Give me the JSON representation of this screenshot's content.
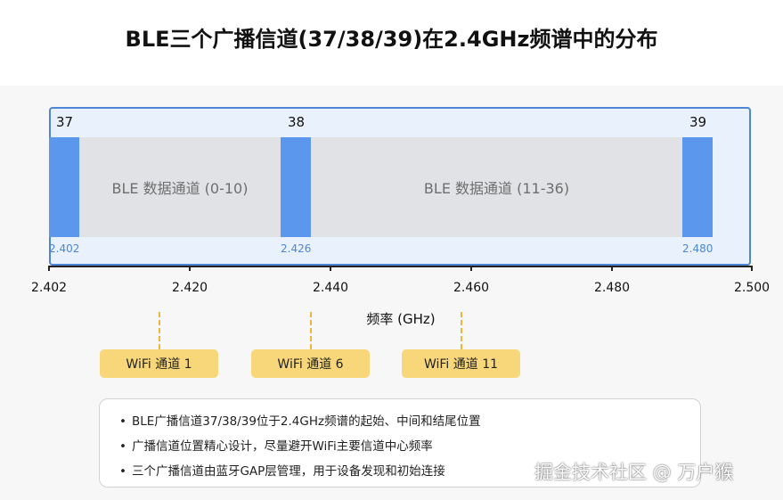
{
  "title": "BLE三个广播信道(37/38/39)在2.4GHz频谱中的分布",
  "chart_data": {
    "type": "diagram",
    "xlim": [
      2.402,
      2.5
    ],
    "x_ticks": [
      "2.402",
      "2.420",
      "2.440",
      "2.460",
      "2.480",
      "2.500"
    ],
    "x_label": "频率 (GHz)",
    "advertising_channels": [
      {
        "channel": "37",
        "freq_label": "2.402"
      },
      {
        "channel": "38",
        "freq_label": "2.426"
      },
      {
        "channel": "39",
        "freq_label": "2.480"
      }
    ],
    "data_regions": [
      {
        "label": "BLE 数据通道 (0-10)"
      },
      {
        "label": "BLE 数据通道 (11-36)"
      }
    ],
    "wifi_channels": [
      {
        "label": "WiFi 通道 1"
      },
      {
        "label": "WiFi 通道 6"
      },
      {
        "label": "WiFi 通道 11"
      }
    ]
  },
  "notes": [
    "BLE广播信道37/38/39位于2.4GHz频谱的起始、中间和结尾位置",
    "广播信道位置精心设计，尽量避开WiFi主要信道中心频率",
    "三个广播信道由蓝牙GAP层管理，用于设备发现和初始连接"
  ],
  "bullet": "•",
  "watermark": "掘金技术社区 @ 万户猴",
  "colors": {
    "advertising_bar": "#5b97ed",
    "panel_border": "#4d86d6",
    "panel_fill": "#e9f1fd",
    "data_region": "#e0e2e5",
    "wifi_badge": "#f7d77a",
    "wifi_dash": "#f0b43a"
  }
}
